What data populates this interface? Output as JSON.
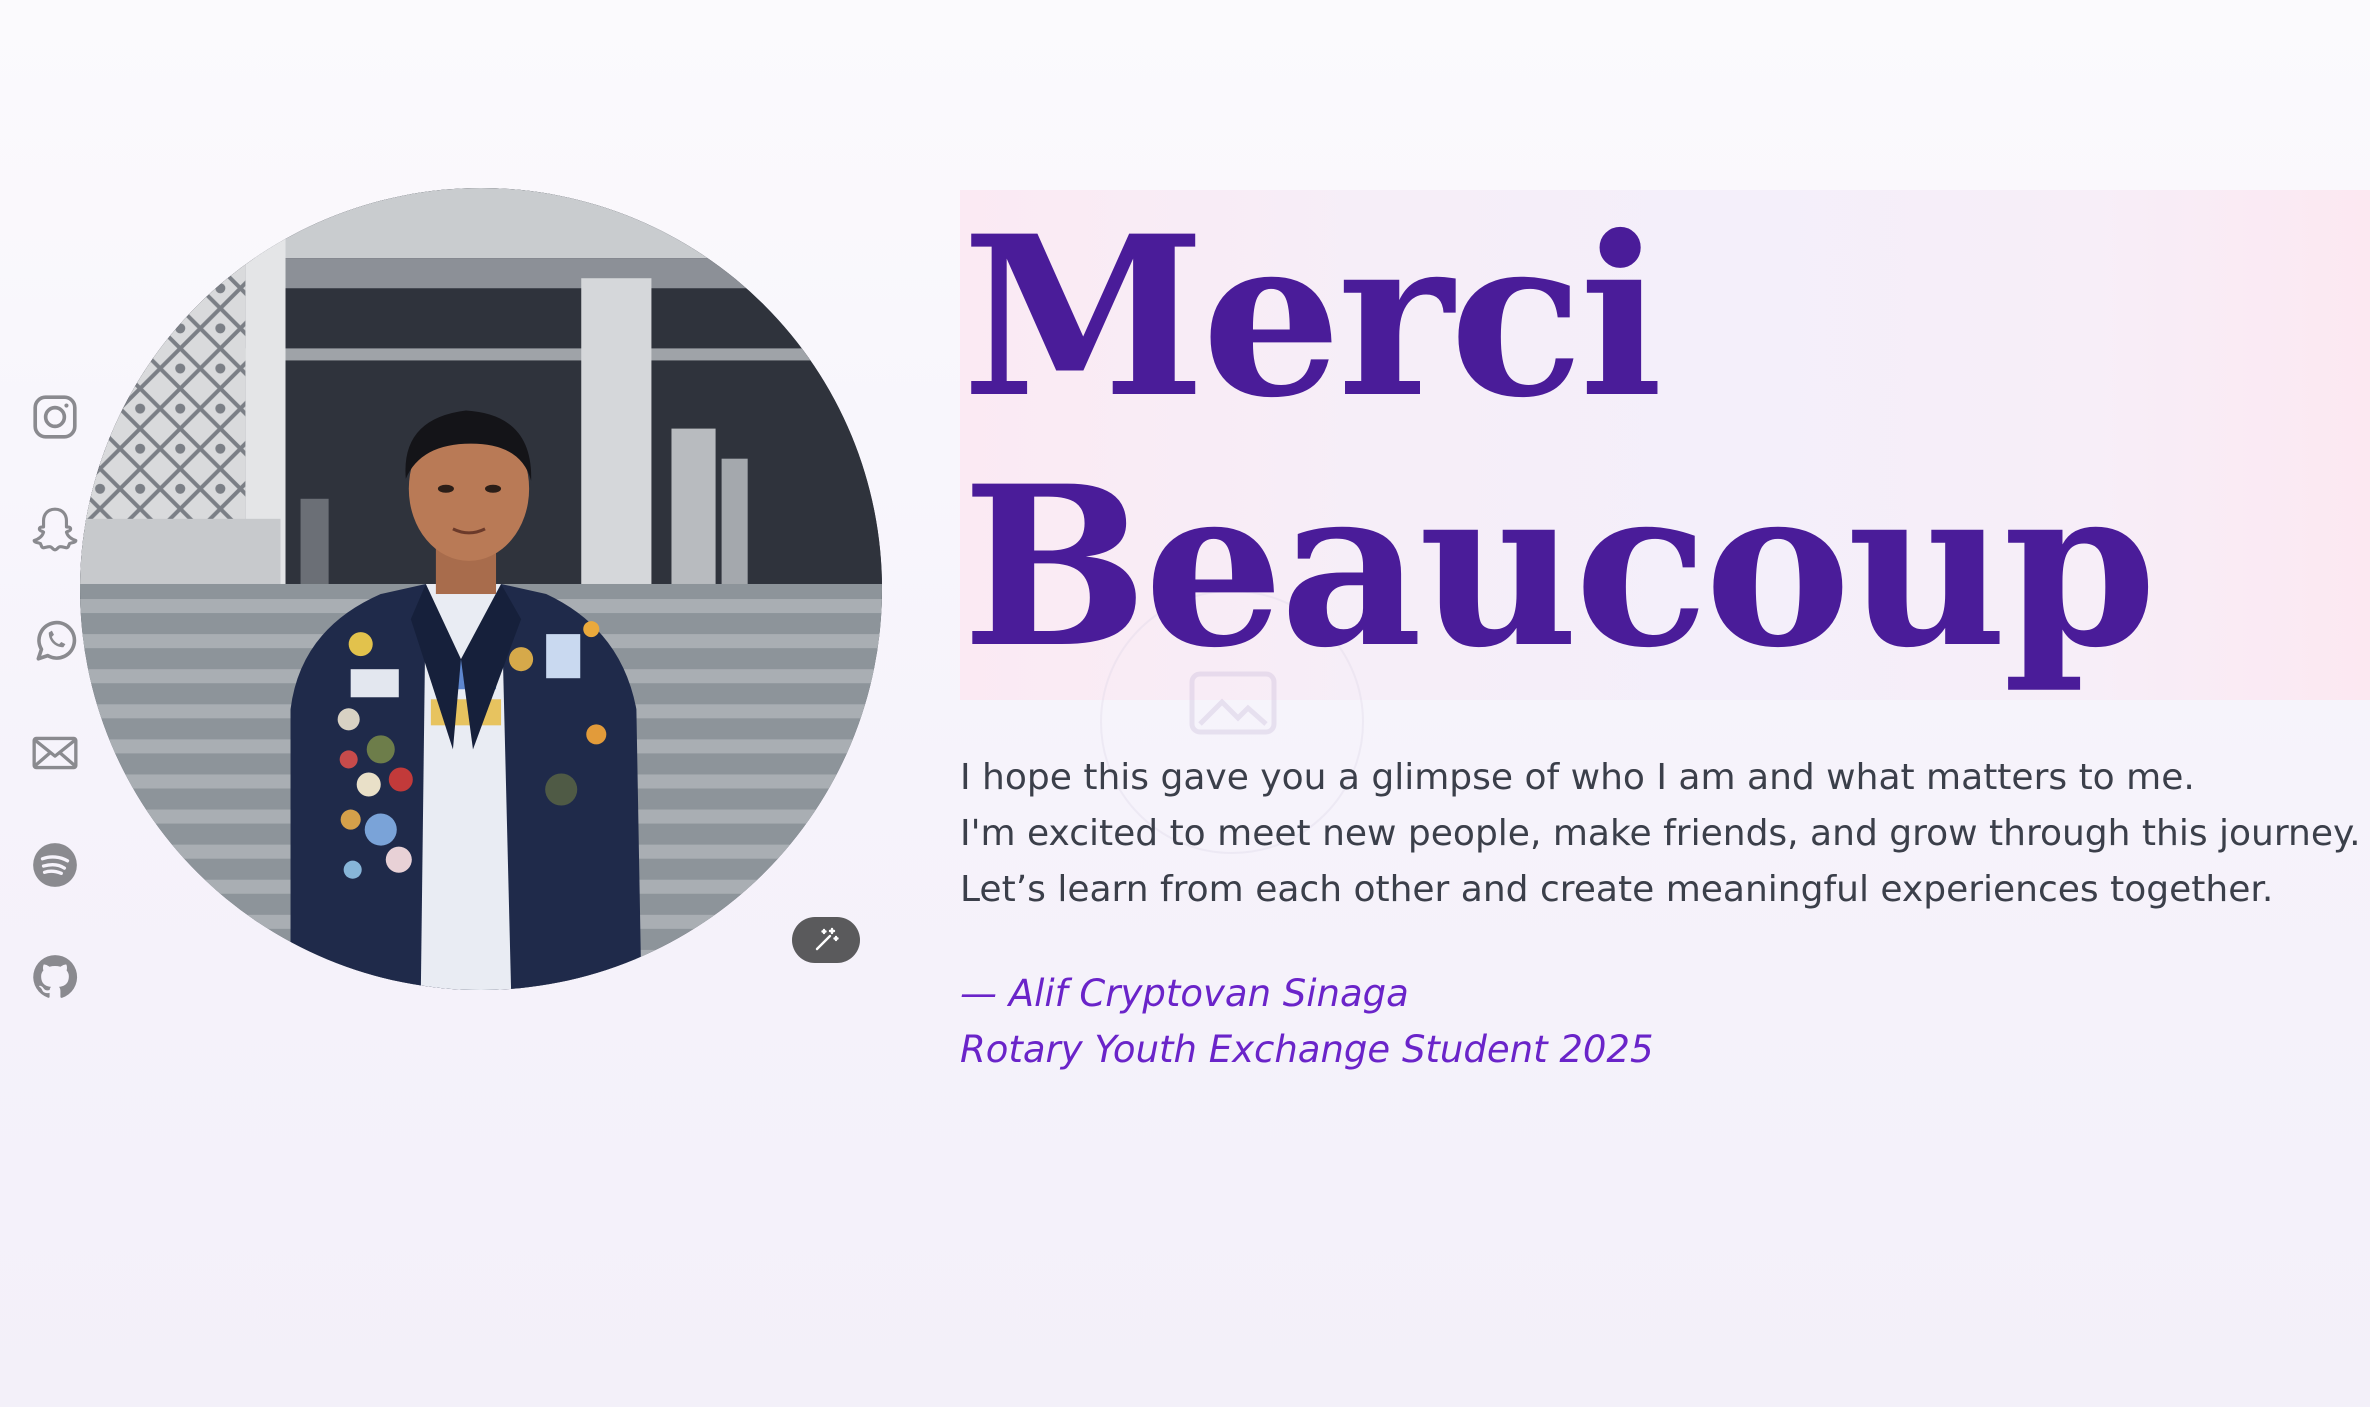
{
  "heading": {
    "line1": "Merci",
    "line2": "Beaucoup"
  },
  "message": {
    "line1": "I hope this gave you a glimpse of who I am and what matters to me.",
    "line2": "I'm excited to meet new people, make friends, and grow through this journey.",
    "line3": "Let’s learn from each other and create meaningful experiences together."
  },
  "signature": {
    "name": "— Alif Cryptovan Sinaga",
    "role": "Rotary Youth Exchange Student 2025"
  },
  "social": [
    {
      "icon": "instagram-icon"
    },
    {
      "icon": "snapchat-icon"
    },
    {
      "icon": "whatsapp-icon"
    },
    {
      "icon": "mail-icon"
    },
    {
      "icon": "spotify-icon"
    },
    {
      "icon": "github-icon"
    }
  ],
  "colors": {
    "heading": "#4a1c99",
    "signature": "#6a24c9",
    "body_text": "#3b3f4a",
    "icons": "#8a8a8f"
  }
}
